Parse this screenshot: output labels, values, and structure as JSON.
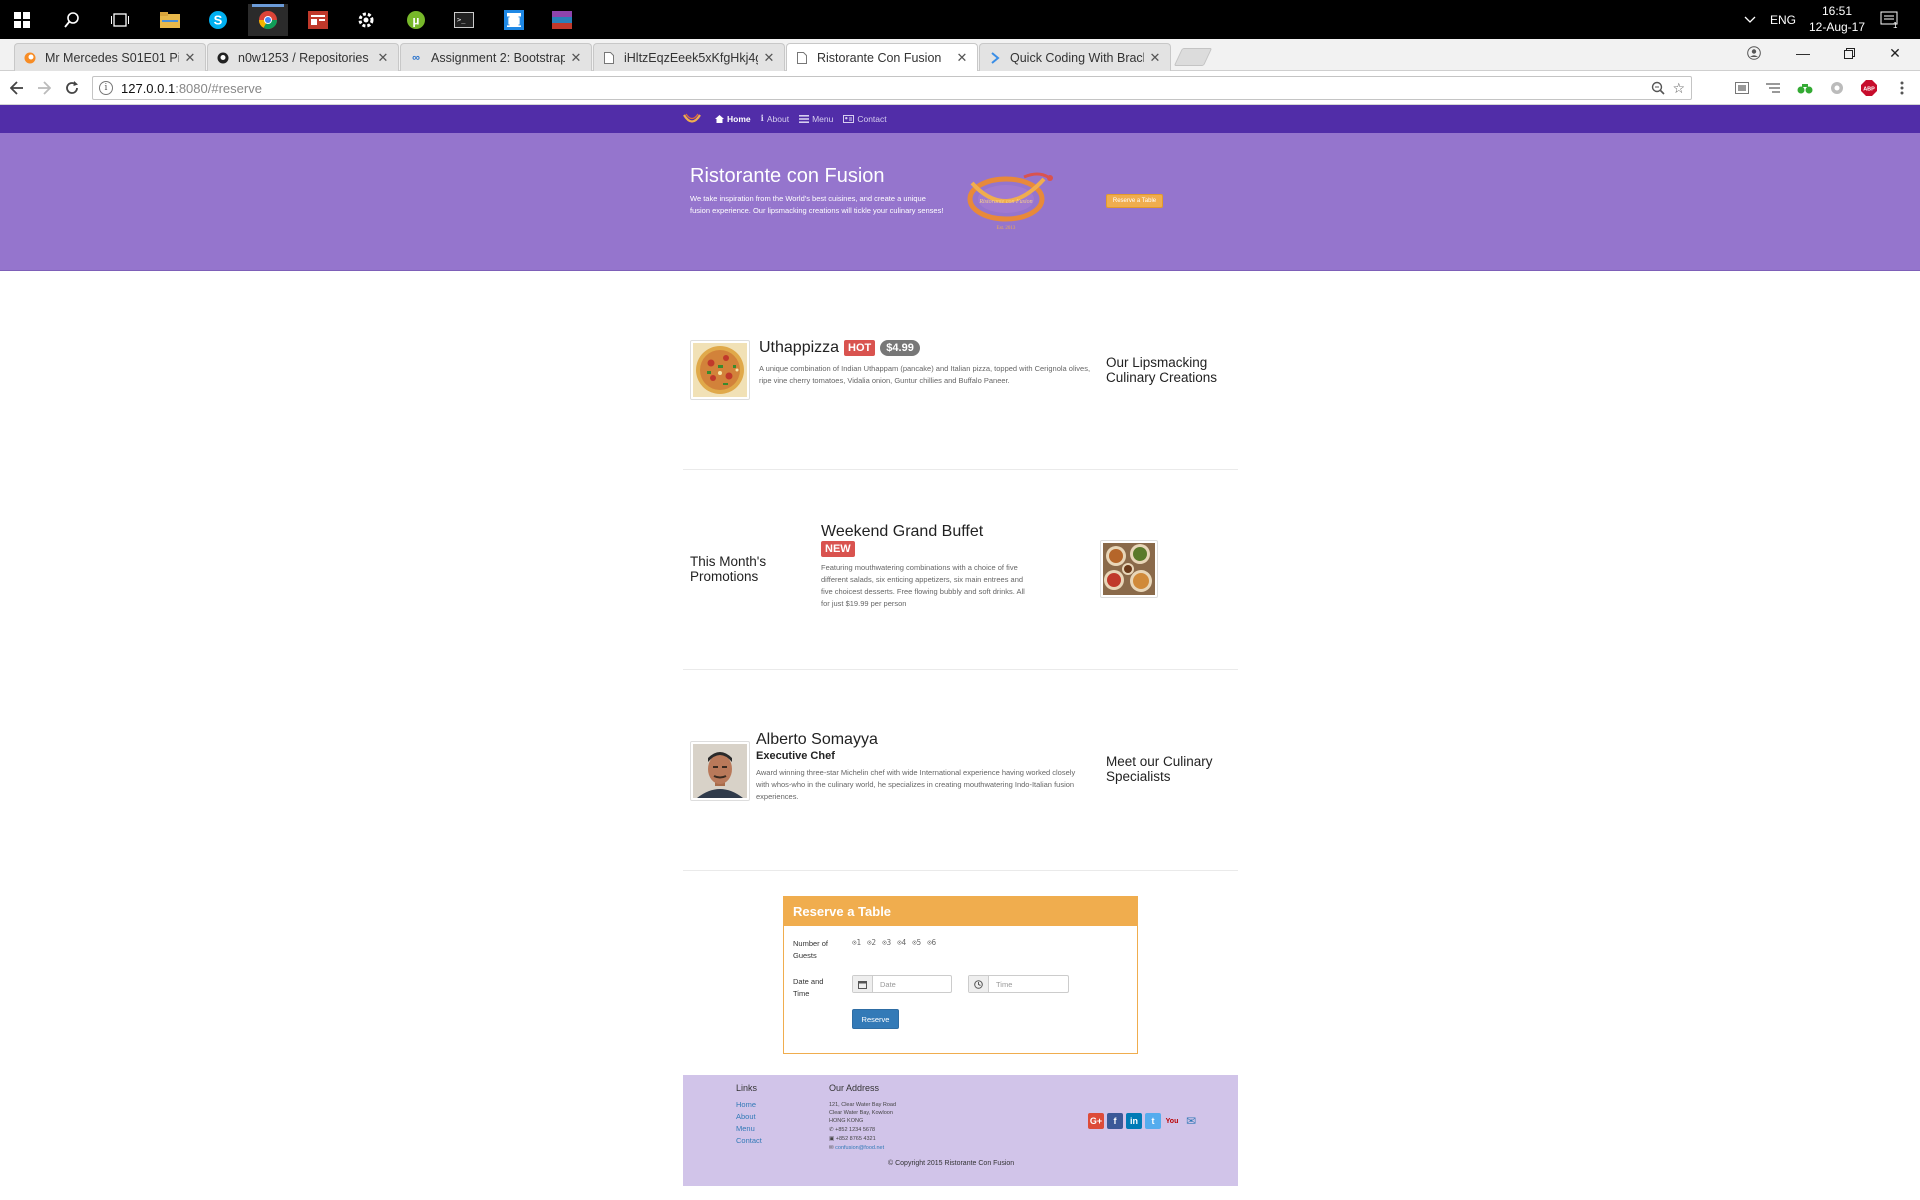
{
  "taskbar": {
    "language": "ENG",
    "time": "16:51",
    "date": "12-Aug-17",
    "notification_count": "1",
    "app_icons": [
      "windows-start-icon",
      "search-icon",
      "task-view-icon",
      "file-explorer-icon",
      "skype-icon",
      "chrome-icon",
      "news-app-icon",
      "settings-icon",
      "utorrent-icon",
      "terminal-icon",
      "brackets-icon",
      "winrar-icon"
    ]
  },
  "browser": {
    "tabs": [
      {
        "title": "Mr Mercedes S01E01 Pil",
        "icon": "crunchyroll-favicon"
      },
      {
        "title": "n0w1253 / Repositories",
        "icon": "github-favicon"
      },
      {
        "title": "Assignment 2: Bootstrap",
        "icon": "coursera-favicon"
      },
      {
        "title": "iHltzEqzEeek5xKfgHkj4g",
        "icon": "page-favicon"
      },
      {
        "title": "Ristorante Con Fusion",
        "icon": "page-favicon"
      },
      {
        "title": "Quick Coding With Brack",
        "icon": "brackets-favicon"
      }
    ],
    "active_tab": 4,
    "url_host": "127.0.0.1",
    "url_path": ":8080/#reserve"
  },
  "site": {
    "nav": {
      "links": [
        {
          "label": "Home",
          "icon": "home-icon"
        },
        {
          "label": "About",
          "icon": "info-icon"
        },
        {
          "label": "Menu",
          "icon": "list-icon"
        },
        {
          "label": "Contact",
          "icon": "address-card-icon"
        }
      ]
    },
    "jumbotron": {
      "title": "Ristorante con Fusion",
      "text": "We take inspiration from the World's best cuisines, and create a unique fusion experience. Our lipsmacking creations will tickle your culinary senses!",
      "logo_text": "Ristorante con Fusion",
      "logo_est": "Est. 2013",
      "reserve_button": "Reserve a Table"
    },
    "dish": {
      "name": "Uthappizza",
      "label": "HOT",
      "price": "$4.99",
      "description": "A unique combination of Indian Uthappam (pancake) and Italian pizza, topped with Cerignola olives, ripe vine cherry tomatoes, Vidalia onion, Guntur chillies and Buffalo Paneer.",
      "side_heading": "Our Lipsmacking Culinary Creations"
    },
    "promotion": {
      "side_heading": "This Month's Promotions",
      "name": "Weekend Grand Buffet",
      "label": "NEW",
      "description": "Featuring mouthwatering combinations with a choice of five different salads, six enticing appetizers, six main entrees and five choicest desserts. Free flowing bubbly and soft drinks. All for just $19.99 per person"
    },
    "leader": {
      "name": "Alberto Somayya",
      "designation": "Executive Chef",
      "description": "Award winning three-star Michelin chef with wide International experience having worked closely with whos-who in the culinary world, he specializes in creating mouthwatering Indo-Italian fusion experiences.",
      "side_heading": "Meet our Culinary Specialists"
    },
    "reserve": {
      "title": "Reserve a Table",
      "guests_label": "Number of Guests",
      "guest_options": [
        "1",
        "2",
        "3",
        "4",
        "5",
        "6"
      ],
      "datetime_label": "Date and Time",
      "date_placeholder": "Date",
      "time_placeholder": "Time",
      "submit": "Reserve"
    },
    "footer": {
      "links_heading": "Links",
      "links": [
        "Home",
        "About",
        "Menu",
        "Contact"
      ],
      "address_heading": "Our Address",
      "address_lines": [
        "121, Clear Water Bay Road",
        "Clear Water Bay, Kowloon",
        "HONG KONG"
      ],
      "phone": "+852 1234 5678",
      "fax": "+852 8765 4321",
      "email": "confusion@food.net",
      "copyright": "© Copyright 2015 Ristorante Con Fusion",
      "social": [
        {
          "icon": "google-plus-icon",
          "text": "G+",
          "color": "#dd4b39"
        },
        {
          "icon": "facebook-icon",
          "text": "f",
          "color": "#3b5998"
        },
        {
          "icon": "linkedin-icon",
          "text": "in",
          "color": "#007bb6"
        },
        {
          "icon": "twitter-icon",
          "text": "t",
          "color": "#55acee"
        },
        {
          "icon": "youtube-icon",
          "text": "You",
          "color": "#bb0000"
        },
        {
          "icon": "mail-icon",
          "text": "✉",
          "color": "#337ab7"
        }
      ]
    },
    "colors": {
      "nav": "#512da8",
      "jumbotron": "#9575cd",
      "footer": "#d1c4e9",
      "warning": "#f0ad4e",
      "danger": "#d9534f",
      "primary": "#337ab7"
    }
  }
}
